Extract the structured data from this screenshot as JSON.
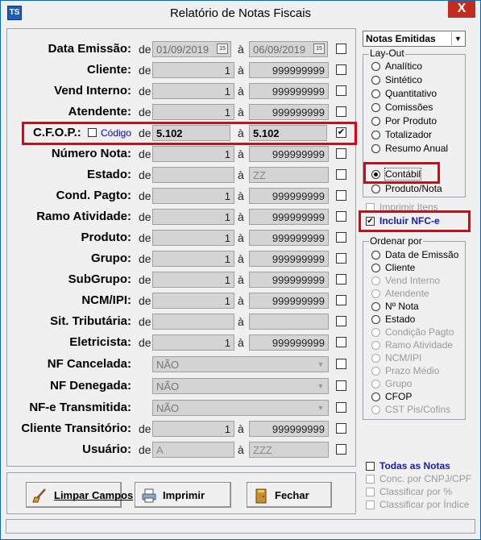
{
  "window": {
    "title": "Relatório de Notas Fiscais",
    "close": "X"
  },
  "labels": {
    "de": "de",
    "a": "à",
    "data_emissao": "Data Emissão:",
    "cliente": "Cliente:",
    "vend_interno": "Vend Interno:",
    "atendente": "Atendente:",
    "cfop": "C.F.O.P.:",
    "cfop_codigo": "Código",
    "numero_nota": "Número Nota:",
    "estado": "Estado:",
    "cond_pagto": "Cond. Pagto:",
    "ramo_atividade": "Ramo Atividade:",
    "produto": "Produto:",
    "grupo": "Grupo:",
    "subgrupo": "SubGrupo:",
    "ncm_ipi": "NCM/IPI:",
    "sit_tributaria": "Sit. Tributária:",
    "eletricista": "Eletricista:",
    "nf_cancelada": "NF Cancelada:",
    "nf_denegada": "NF Denegada:",
    "nfe_transmitida": "NF-e Transmitida:",
    "cliente_transitorio": "Cliente Transitório:",
    "usuario": "Usuário:"
  },
  "values": {
    "data_from": "01/09/2019",
    "data_to": "06/09/2019",
    "one": "1",
    "nines": "999999999",
    "cfop_from": "5.102",
    "cfop_to": "5.102",
    "estado_from": "",
    "estado_to": "ZZ",
    "nao": "NÃO",
    "usuario_from": "A",
    "usuario_to": "ZZZ",
    "cal_icon_text": "15"
  },
  "right": {
    "report_type": "Notas Emitidas",
    "layout_legend": "Lay-Out",
    "layouts": [
      "Analítico",
      "Sintético",
      "Quantitativo",
      "Comissões",
      "Por Produto",
      "Totalizador",
      "Resumo Anual"
    ],
    "contabil": "Contábil",
    "produto_nota": "Produto/Nota",
    "imprimir_itens": "Imprimir Itens",
    "incluir_nfce": "Incluir NFC-e",
    "ordenar_legend": "Ordenar por",
    "ordenar": [
      "Data de Emissão",
      "Cliente",
      "Vend Interno",
      "Atendente",
      "Nº Nota",
      "Estado",
      "Condição Pagto",
      "Ramo Atividade",
      "NCM/IPI",
      "Prazo Médio",
      "Grupo",
      "CFOP",
      "CST Pis/Cofins"
    ],
    "todas_notas": "Todas as Notas",
    "conc_cnpj": "Conc. por CNPJ/CPF",
    "classificar_pct": "Classificar por %",
    "classificar_indice": "Classificar por Índice"
  },
  "buttons": {
    "limpar": "Limpar Campos",
    "imprimir": "Imprimir",
    "fechar": "Fechar"
  },
  "colors": {
    "highlight": "#e8000e",
    "link_blue": "#0000c8",
    "accent_blue": "#1a1ab0"
  }
}
